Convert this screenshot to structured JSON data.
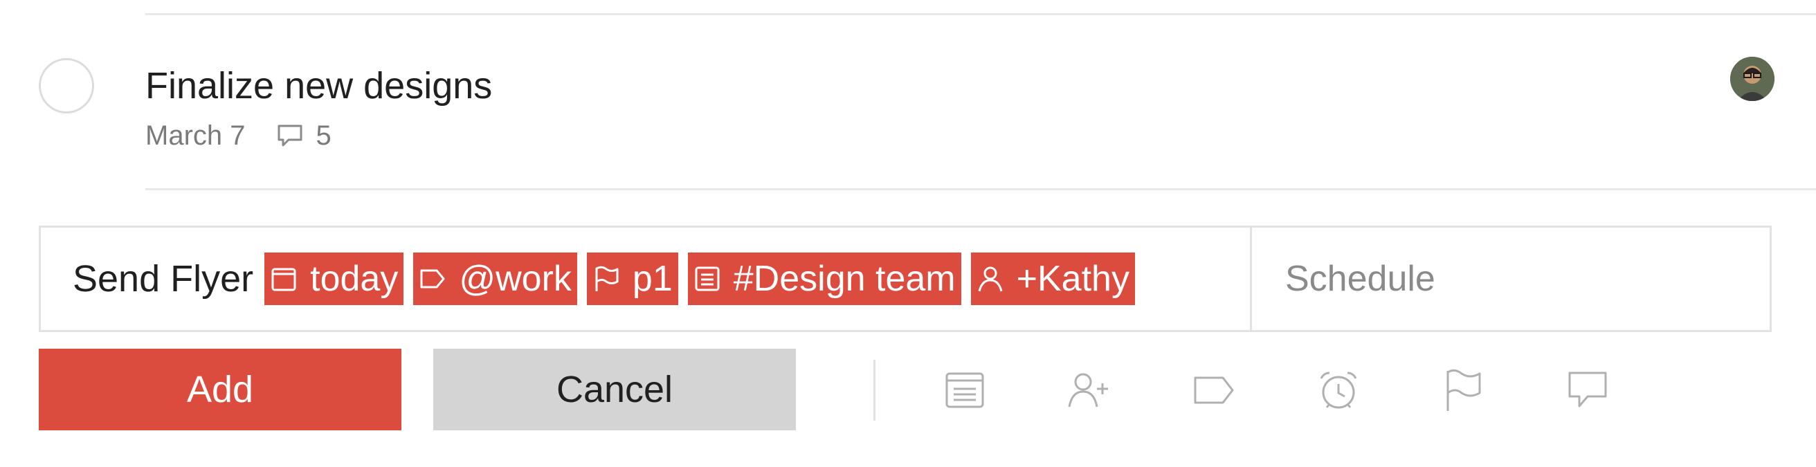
{
  "task": {
    "title": "Finalize new designs",
    "date": "March 7",
    "comment_count": "5"
  },
  "editor": {
    "text": "Send Flyer",
    "tokens": {
      "date": {
        "label": "today",
        "icon": "calendar-icon"
      },
      "label": {
        "label": "@work",
        "icon": "label-icon"
      },
      "priority": {
        "label": "p1",
        "icon": "flag-icon"
      },
      "project": {
        "label": "#Design team",
        "icon": "project-list-icon"
      },
      "assignee": {
        "label": "+Kathy",
        "icon": "person-icon"
      }
    },
    "schedule_placeholder": "Schedule"
  },
  "actions": {
    "add_label": "Add",
    "cancel_label": "Cancel"
  },
  "toolbar_icons": [
    "project-icon",
    "assign-user-icon",
    "label-icon",
    "reminder-alarm-icon",
    "priority-flag-icon",
    "comment-icon"
  ],
  "colors": {
    "accent": "#db4c3f",
    "cancel_bg": "#d4d4d4",
    "icon_gray": "#b0b0b0"
  }
}
